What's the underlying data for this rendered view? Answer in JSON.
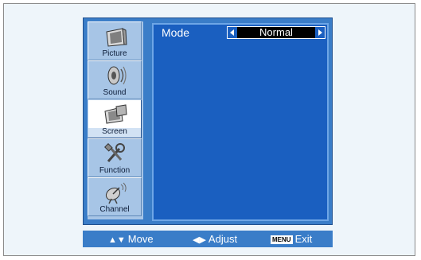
{
  "menu": {
    "items": [
      {
        "label": "Picture",
        "icon": "picture-icon",
        "selected": false
      },
      {
        "label": "Sound",
        "icon": "sound-icon",
        "selected": false
      },
      {
        "label": "Screen",
        "icon": "screen-icon",
        "selected": true
      },
      {
        "label": "Function",
        "icon": "function-icon",
        "selected": false
      },
      {
        "label": "Channel",
        "icon": "channel-icon",
        "selected": false
      }
    ]
  },
  "content": {
    "mode": {
      "label": "Mode",
      "value": "Normal"
    }
  },
  "help": {
    "move": "Move",
    "adjust": "Adjust",
    "menu_key": "MENU",
    "exit": "Exit"
  },
  "colors": {
    "panel": "#3a7dc8",
    "content_bg": "#1a5fc0",
    "menu_bg": "#a7c5e6",
    "value_bg": "#000000"
  }
}
